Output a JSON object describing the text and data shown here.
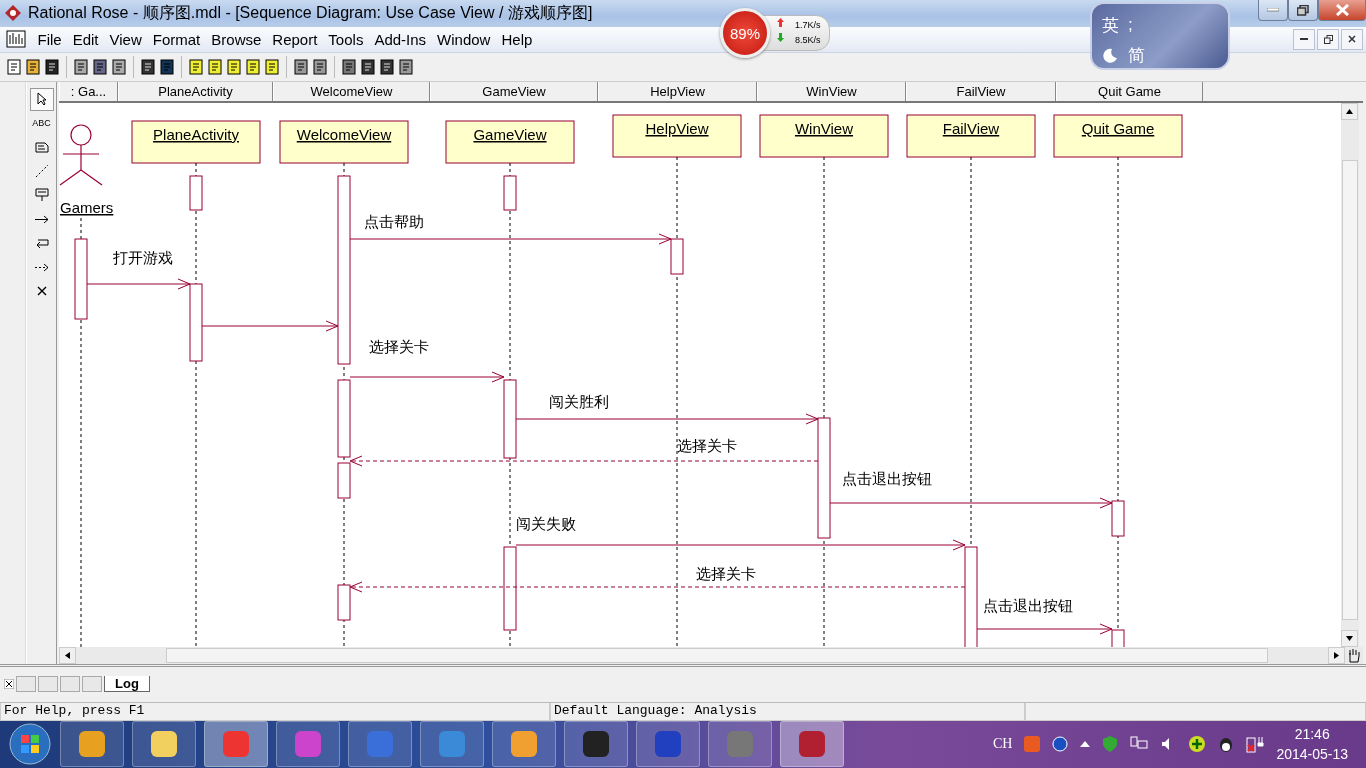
{
  "window": {
    "title": "Rational Rose - 顺序图.mdl - [Sequence Diagram: Use Case View / 游戏顺序图]"
  },
  "net_widget": {
    "cpu": "89%",
    "up": "1.7K/s",
    "down": "8.5K/s"
  },
  "ime_widget": {
    "lang": "英",
    "punct": ";",
    "script": "简"
  },
  "menu": [
    "File",
    "Edit",
    "View",
    "Format",
    "Browse",
    "Report",
    "Tools",
    "Add-Ins",
    "Window",
    "Help"
  ],
  "toolbox": [
    {
      "kind": "pointer",
      "selected": true
    },
    {
      "kind": "text",
      "label": "ABC",
      "selected": false
    },
    {
      "kind": "note",
      "selected": false
    },
    {
      "kind": "anchor",
      "selected": false
    },
    {
      "kind": "object",
      "selected": false
    },
    {
      "kind": "message",
      "selected": false
    },
    {
      "kind": "self",
      "selected": false
    },
    {
      "kind": "return",
      "selected": false
    },
    {
      "kind": "destroy",
      "selected": false
    }
  ],
  "header_columns": [
    ": Ga...",
    "PlaneActivity",
    "WelcomeView",
    "GameView",
    "HelpView",
    "WinView",
    "FailView",
    "Quit Game"
  ],
  "lifelines": [
    {
      "name": "Gamers",
      "kind": "actor"
    },
    {
      "name": "PlaneActivity",
      "kind": "object"
    },
    {
      "name": "WelcomeView",
      "kind": "object"
    },
    {
      "name": "GameView",
      "kind": "object"
    },
    {
      "name": "HelpView",
      "kind": "object"
    },
    {
      "name": "WinView",
      "kind": "object"
    },
    {
      "name": "FailView",
      "kind": "object"
    },
    {
      "name": "Quit Game",
      "kind": "object"
    }
  ],
  "messages": [
    {
      "label": "点击帮助",
      "kind": "call"
    },
    {
      "label": "打开游戏",
      "kind": "call"
    },
    {
      "kind": "call"
    },
    {
      "label": "选择关卡",
      "kind": "call"
    },
    {
      "label": "闯关胜利",
      "kind": "call"
    },
    {
      "label": "选择关卡",
      "kind": "return"
    },
    {
      "label": "点击退出按钮",
      "kind": "call"
    },
    {
      "label": "闯关失败",
      "kind": "call"
    },
    {
      "label": "选择关卡",
      "kind": "return"
    },
    {
      "label": "点击退出按钮",
      "kind": "call"
    }
  ],
  "log_tabs": [
    {
      "label": "Log",
      "selected": true
    }
  ],
  "status_bar": {
    "help": "For Help, press F1",
    "language": "Default Language: Analysis"
  },
  "tray": {
    "input": "CH",
    "time": "21:46",
    "date": "2014-05-13"
  }
}
